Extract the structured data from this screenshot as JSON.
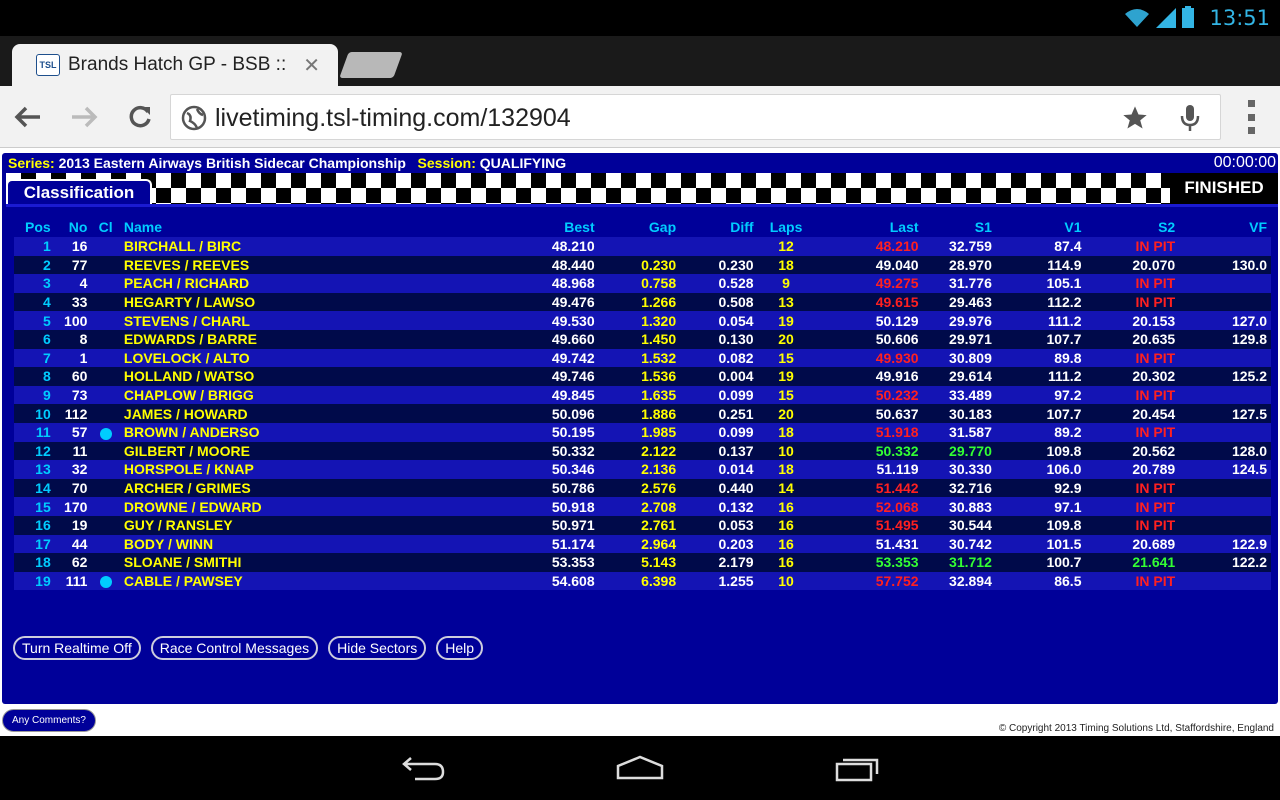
{
  "status_bar": {
    "clock": "13:51"
  },
  "browser": {
    "tab_title": "Brands Hatch GP - BSB ::",
    "tab_close": "✕",
    "favicon_text": "TSL",
    "url": "livetiming.tsl-timing.com/132904"
  },
  "session": {
    "series_label": "Series:",
    "series": "2013 Eastern Airways British Sidecar Championship",
    "session_label": "Session:",
    "session_name": "QUALIFYING",
    "timer": "00:00:00",
    "tab_label": "Classification",
    "status": "FINISHED"
  },
  "table": {
    "headers": {
      "pos": "Pos",
      "no": "No",
      "cl": "Cl",
      "name": "Name",
      "best": "Best",
      "gap": "Gap",
      "diff": "Diff",
      "laps": "Laps",
      "last": "Last",
      "s1": "S1",
      "v1": "V1",
      "s2": "S2",
      "vf": "VF"
    },
    "rows": [
      {
        "pos": "1",
        "no": "16",
        "cl": false,
        "name": "BIRCHALL / BIRC",
        "best": "48.210",
        "gap": "",
        "diff": "",
        "laps": "12",
        "last": "48.210",
        "last_color": "#ff2020",
        "s1": "32.759",
        "s1_color": "#ffffff",
        "v1": "87.4",
        "s2": "IN PIT",
        "s2_color": "#ff2020",
        "vf": ""
      },
      {
        "pos": "2",
        "no": "77",
        "cl": false,
        "name": "REEVES / REEVES",
        "best": "48.440",
        "gap": "0.230",
        "diff": "0.230",
        "laps": "18",
        "last": "49.040",
        "last_color": "#ffffff",
        "s1": "28.970",
        "s1_color": "#ffffff",
        "v1": "114.9",
        "s2": "20.070",
        "s2_color": "#ffffff",
        "vf": "130.0"
      },
      {
        "pos": "3",
        "no": "4",
        "cl": false,
        "name": "PEACH / RICHARD",
        "best": "48.968",
        "gap": "0.758",
        "diff": "0.528",
        "laps": "9",
        "last": "49.275",
        "last_color": "#ff2020",
        "s1": "31.776",
        "s1_color": "#ffffff",
        "v1": "105.1",
        "s2": "IN PIT",
        "s2_color": "#ff2020",
        "vf": ""
      },
      {
        "pos": "4",
        "no": "33",
        "cl": false,
        "name": "HEGARTY / LAWSO",
        "best": "49.476",
        "gap": "1.266",
        "diff": "0.508",
        "laps": "13",
        "last": "49.615",
        "last_color": "#ff2020",
        "s1": "29.463",
        "s1_color": "#ffffff",
        "v1": "112.2",
        "s2": "IN PIT",
        "s2_color": "#ff2020",
        "vf": ""
      },
      {
        "pos": "5",
        "no": "100",
        "cl": false,
        "name": "STEVENS / CHARL",
        "best": "49.530",
        "gap": "1.320",
        "diff": "0.054",
        "laps": "19",
        "last": "50.129",
        "last_color": "#ffffff",
        "s1": "29.976",
        "s1_color": "#ffffff",
        "v1": "111.2",
        "s2": "20.153",
        "s2_color": "#ffffff",
        "vf": "127.0"
      },
      {
        "pos": "6",
        "no": "8",
        "cl": false,
        "name": "EDWARDS / BARRE",
        "best": "49.660",
        "gap": "1.450",
        "diff": "0.130",
        "laps": "20",
        "last": "50.606",
        "last_color": "#ffffff",
        "s1": "29.971",
        "s1_color": "#ffffff",
        "v1": "107.7",
        "s2": "20.635",
        "s2_color": "#ffffff",
        "vf": "129.8"
      },
      {
        "pos": "7",
        "no": "1",
        "cl": false,
        "name": "LOVELOCK / ALTO",
        "best": "49.742",
        "gap": "1.532",
        "diff": "0.082",
        "laps": "15",
        "last": "49.930",
        "last_color": "#ff2020",
        "s1": "30.809",
        "s1_color": "#ffffff",
        "v1": "89.8",
        "s2": "IN PIT",
        "s2_color": "#ff2020",
        "vf": ""
      },
      {
        "pos": "8",
        "no": "60",
        "cl": false,
        "name": "HOLLAND / WATSO",
        "best": "49.746",
        "gap": "1.536",
        "diff": "0.004",
        "laps": "19",
        "last": "49.916",
        "last_color": "#ffffff",
        "s1": "29.614",
        "s1_color": "#ffffff",
        "v1": "111.2",
        "s2": "20.302",
        "s2_color": "#ffffff",
        "vf": "125.2"
      },
      {
        "pos": "9",
        "no": "73",
        "cl": false,
        "name": "CHAPLOW / BRIGG",
        "best": "49.845",
        "gap": "1.635",
        "diff": "0.099",
        "laps": "15",
        "last": "50.232",
        "last_color": "#ff2020",
        "s1": "33.489",
        "s1_color": "#ffffff",
        "v1": "97.2",
        "s2": "IN PIT",
        "s2_color": "#ff2020",
        "vf": ""
      },
      {
        "pos": "10",
        "no": "112",
        "cl": false,
        "name": "JAMES / HOWARD",
        "best": "50.096",
        "gap": "1.886",
        "diff": "0.251",
        "laps": "20",
        "last": "50.637",
        "last_color": "#ffffff",
        "s1": "30.183",
        "s1_color": "#ffffff",
        "v1": "107.7",
        "s2": "20.454",
        "s2_color": "#ffffff",
        "vf": "127.5"
      },
      {
        "pos": "11",
        "no": "57",
        "cl": true,
        "name": "BROWN / ANDERSO",
        "best": "50.195",
        "gap": "1.985",
        "diff": "0.099",
        "laps": "18",
        "last": "51.918",
        "last_color": "#ff2020",
        "s1": "31.587",
        "s1_color": "#ffffff",
        "v1": "89.2",
        "s2": "IN PIT",
        "s2_color": "#ff2020",
        "vf": ""
      },
      {
        "pos": "12",
        "no": "11",
        "cl": false,
        "name": "GILBERT / MOORE",
        "best": "50.332",
        "gap": "2.122",
        "diff": "0.137",
        "laps": "10",
        "last": "50.332",
        "last_color": "#33ff33",
        "s1": "29.770",
        "s1_color": "#33ff33",
        "v1": "109.8",
        "s2": "20.562",
        "s2_color": "#ffffff",
        "vf": "128.0"
      },
      {
        "pos": "13",
        "no": "32",
        "cl": false,
        "name": "HORSPOLE / KNAP",
        "best": "50.346",
        "gap": "2.136",
        "diff": "0.014",
        "laps": "18",
        "last": "51.119",
        "last_color": "#ffffff",
        "s1": "30.330",
        "s1_color": "#ffffff",
        "v1": "106.0",
        "s2": "20.789",
        "s2_color": "#ffffff",
        "vf": "124.5"
      },
      {
        "pos": "14",
        "no": "70",
        "cl": false,
        "name": "ARCHER / GRIMES",
        "best": "50.786",
        "gap": "2.576",
        "diff": "0.440",
        "laps": "14",
        "last": "51.442",
        "last_color": "#ff2020",
        "s1": "32.716",
        "s1_color": "#ffffff",
        "v1": "92.9",
        "s2": "IN PIT",
        "s2_color": "#ff2020",
        "vf": ""
      },
      {
        "pos": "15",
        "no": "170",
        "cl": false,
        "name": "DROWNE / EDWARD",
        "best": "50.918",
        "gap": "2.708",
        "diff": "0.132",
        "laps": "16",
        "last": "52.068",
        "last_color": "#ff2020",
        "s1": "30.883",
        "s1_color": "#ffffff",
        "v1": "97.1",
        "s2": "IN PIT",
        "s2_color": "#ff2020",
        "vf": ""
      },
      {
        "pos": "16",
        "no": "19",
        "cl": false,
        "name": "GUY / RANSLEY",
        "best": "50.971",
        "gap": "2.761",
        "diff": "0.053",
        "laps": "16",
        "last": "51.495",
        "last_color": "#ff2020",
        "s1": "30.544",
        "s1_color": "#ffffff",
        "v1": "109.8",
        "s2": "IN PIT",
        "s2_color": "#ff2020",
        "vf": ""
      },
      {
        "pos": "17",
        "no": "44",
        "cl": false,
        "name": "BODY / WINN",
        "best": "51.174",
        "gap": "2.964",
        "diff": "0.203",
        "laps": "16",
        "last": "51.431",
        "last_color": "#ffffff",
        "s1": "30.742",
        "s1_color": "#ffffff",
        "v1": "101.5",
        "s2": "20.689",
        "s2_color": "#ffffff",
        "vf": "122.9"
      },
      {
        "pos": "18",
        "no": "62",
        "cl": false,
        "name": "SLOANE / SMITHI",
        "best": "53.353",
        "gap": "5.143",
        "diff": "2.179",
        "laps": "16",
        "last": "53.353",
        "last_color": "#33ff33",
        "s1": "31.712",
        "s1_color": "#33ff33",
        "v1": "100.7",
        "s2": "21.641",
        "s2_color": "#33ff33",
        "vf": "122.2"
      },
      {
        "pos": "19",
        "no": "111",
        "cl": true,
        "name": "CABLE / PAWSEY",
        "best": "54.608",
        "gap": "6.398",
        "diff": "1.255",
        "laps": "10",
        "last": "57.752",
        "last_color": "#ff2020",
        "s1": "32.894",
        "s1_color": "#ffffff",
        "v1": "86.5",
        "s2": "IN PIT",
        "s2_color": "#ff2020",
        "vf": ""
      }
    ]
  },
  "buttons": {
    "realtime": "Turn Realtime Off",
    "race_control": "Race Control Messages",
    "hide_sectors": "Hide Sectors",
    "help": "Help"
  },
  "footer": {
    "comments": "Any Comments?",
    "copyright": "© Copyright 2013 Timing Solutions Ltd, Staffordshire, England"
  },
  "colors": {
    "panel": "#000099",
    "accent": "#00ccff",
    "name": "#ffff00",
    "pb": "#33ff33",
    "slow": "#ff2020",
    "android_clock": "#33b5e5"
  },
  "icons": [
    "wifi-icon",
    "signal-icon",
    "battery-icon",
    "back-arrow-icon",
    "forward-arrow-icon",
    "reload-icon",
    "globe-icon",
    "star-icon",
    "microphone-icon",
    "overflow-menu-icon",
    "android-back-icon",
    "android-home-icon",
    "android-recents-icon"
  ]
}
